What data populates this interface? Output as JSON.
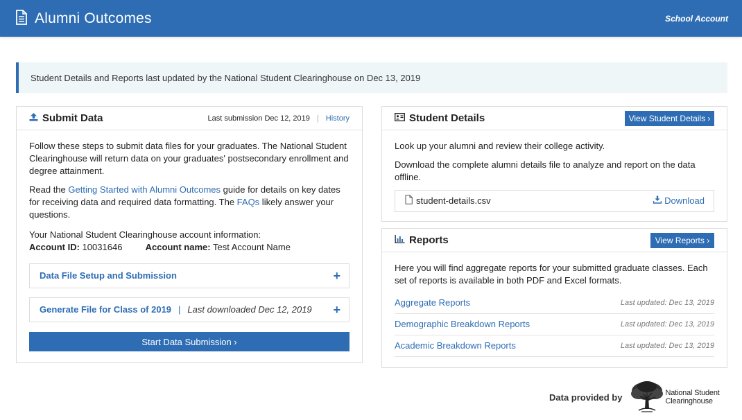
{
  "header": {
    "title": "Alumni Outcomes",
    "account_link": "School Account"
  },
  "notice": {
    "text": "Student Details and Reports last updated by the National Student Clearinghouse on Dec 13, 2019"
  },
  "submit": {
    "title": "Submit Data",
    "last_submission": "Last submission Dec 12, 2019",
    "separator": "|",
    "history_link": "History",
    "intro": "Follow these steps to submit data files for your graduates. The National Student Clearinghouse will return data on your graduates' postsecondary enrollment and degree attainment.",
    "read_prefix": "Read the ",
    "guide_link": "Getting Started with Alumni Outcomes",
    "read_middle": " guide for details on key dates for receiving data and required data formatting. The ",
    "faq_link": "FAQs",
    "read_suffix": " likely answer your questions.",
    "account_info_label": "Your National Student Clearinghouse account information:",
    "account_id_label": "Account ID:",
    "account_id": "10031646",
    "account_name_label": "Account name:",
    "account_name": "Test Account Name",
    "accordion_setup": "Data File Setup and Submission",
    "accordion_generate": "Generate File for Class of 2019",
    "accordion_generate_sep": "|",
    "accordion_generate_meta": "Last downloaded Dec 12, 2019",
    "plus": "+",
    "start_button": "Start Data Submission ›"
  },
  "details": {
    "title": "Student Details",
    "view_button": "View Student Details ›",
    "lookup_text": "Look up your alumni and review their college activity.",
    "download_text": "Download the complete alumni details file to analyze and report on the data offline.",
    "file_name": "student-details.csv",
    "download_link": "Download"
  },
  "reports": {
    "title": "Reports",
    "view_button": "View Reports ›",
    "intro": "Here you will find aggregate reports for your submitted graduate classes. Each set of reports is available in both PDF and Excel formats.",
    "items": [
      {
        "label": "Aggregate Reports",
        "updated": "Last updated: Dec 13, 2019"
      },
      {
        "label": "Demographic Breakdown Reports",
        "updated": "Last updated: Dec 13, 2019"
      },
      {
        "label": "Academic Breakdown Reports",
        "updated": "Last updated: Dec 13, 2019"
      }
    ]
  },
  "footer": {
    "provided_by": "Data provided by",
    "logo_line1": "National Student",
    "logo_line2": "Clearinghouse"
  },
  "colors": {
    "brand": "#2e6db4",
    "notice_bg": "#eef6f8"
  }
}
